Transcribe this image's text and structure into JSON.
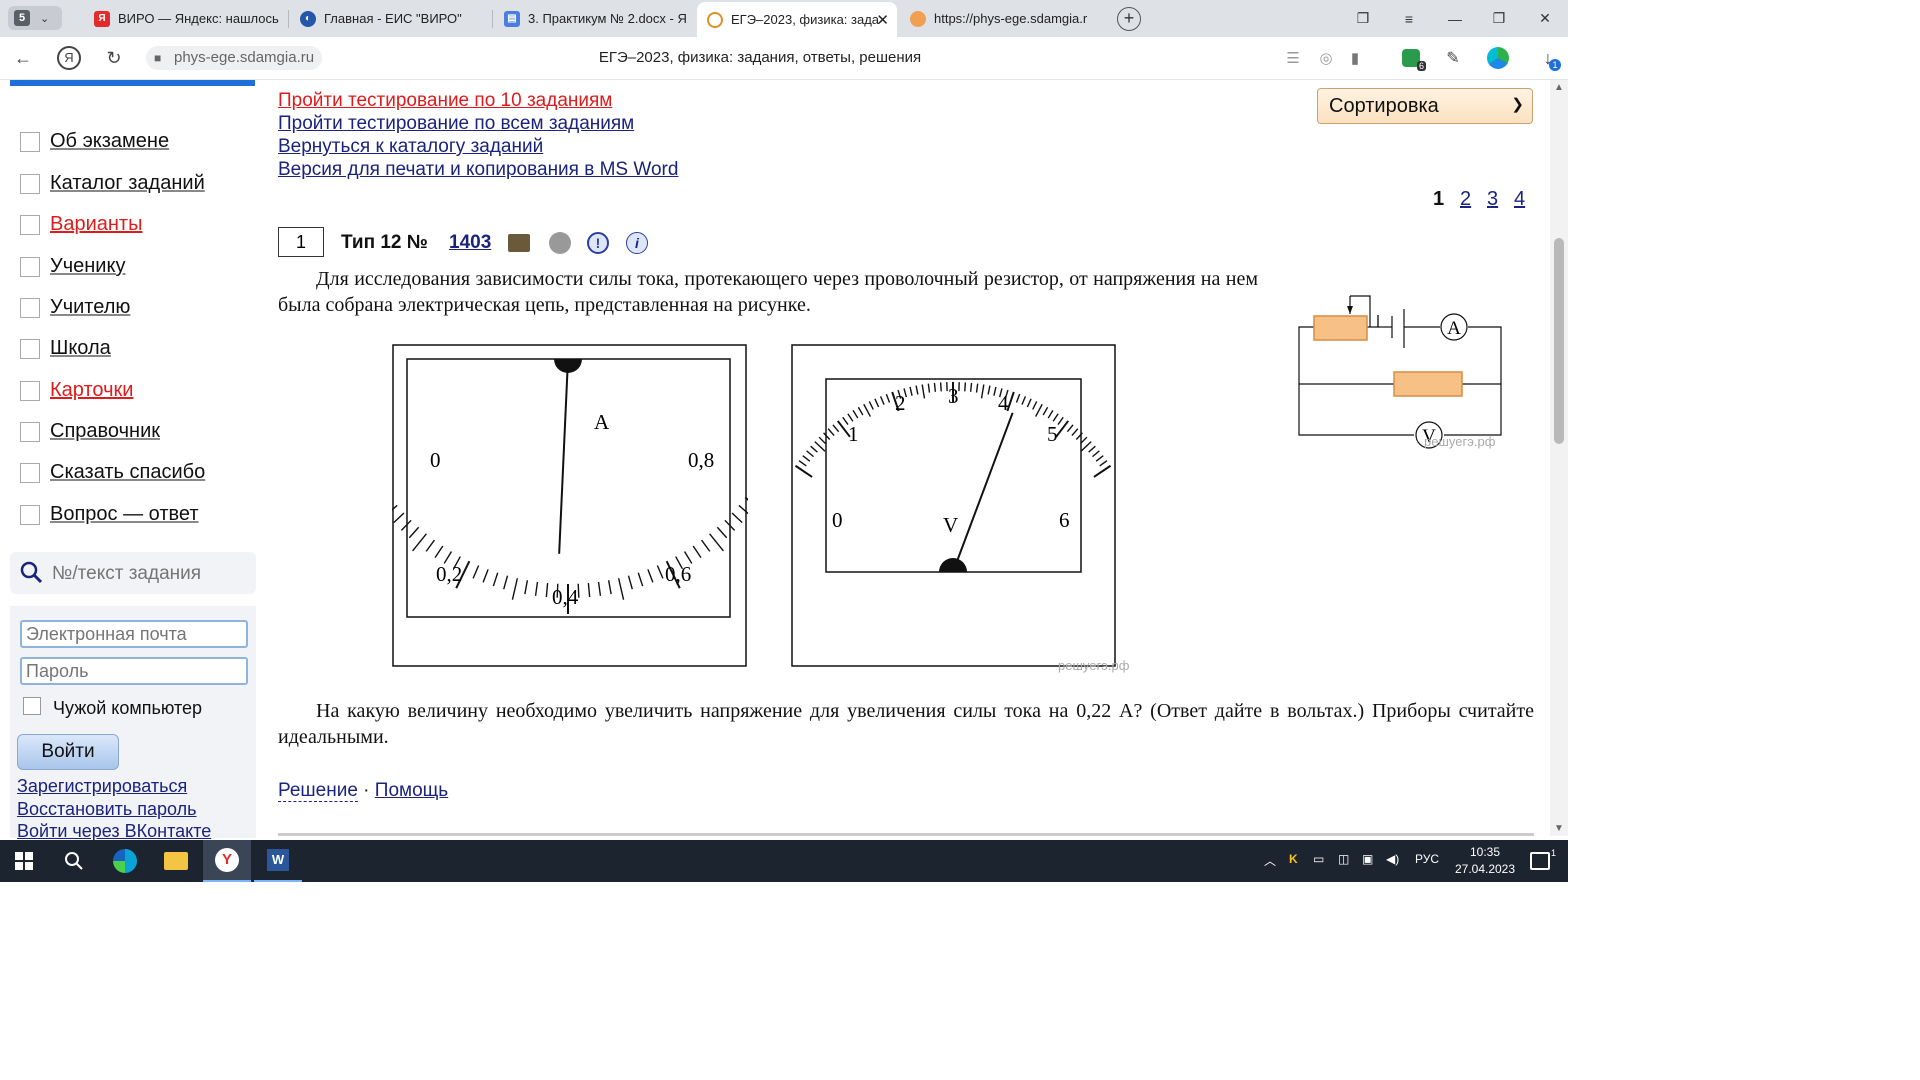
{
  "browser": {
    "tab_counter": "5",
    "tabs": [
      {
        "title": "ВИРО — Яндекс: нашлось"
      },
      {
        "title": "Главная - ЕИС \"ВИРО\""
      },
      {
        "title": "3. Практикум № 2.docx - Я"
      },
      {
        "title": "ЕГЭ–2023, физика: зада"
      },
      {
        "title": "https://phys-ege.sdamgia.r"
      }
    ],
    "domain": "phys-ege.sdamgia.ru",
    "page_title": "ЕГЭ–2023, физика: задания, ответы, решения",
    "extensions_badge": "6",
    "download_badge": "1"
  },
  "sidebar": {
    "nav": [
      {
        "label": "Об экзамене",
        "red": false
      },
      {
        "label": "Каталог заданий",
        "red": false
      },
      {
        "label": "Варианты",
        "red": true
      },
      {
        "label": "Ученику",
        "red": false
      },
      {
        "label": "Учителю",
        "red": false
      },
      {
        "label": "Школа",
        "red": false
      },
      {
        "label": "Карточки",
        "red": true
      },
      {
        "label": "Справочник",
        "red": false
      },
      {
        "label": "Сказать спасибо",
        "red": false
      },
      {
        "label": "Вопрос — ответ",
        "red": false
      }
    ],
    "search_placeholder": "№/текст задания",
    "email_placeholder": "Электронная почта",
    "password_placeholder": "Пароль",
    "foreign_computer": "Чужой компьютер",
    "login_button": "Войти",
    "register": "Зарегистрироваться",
    "restore": "Восстановить пароль",
    "vk": "Войти через ВКонтакте"
  },
  "main": {
    "links": [
      "Пройти тестирование по 10 заданиям",
      "Пройти тестирование по всем заданиям",
      "Вернуться к каталогу заданий",
      "Версия для печати и копирования в MS Word"
    ],
    "sort_label": "Сортировка",
    "pages": [
      "1",
      "2",
      "3",
      "4"
    ],
    "current_page": "1",
    "task": {
      "number": "1",
      "type_label": "Тип 12 №",
      "id": "1403",
      "paragraph1": "Для исследования зависимости силы тока, протекающего через проволочный резистор, от напряжения на нем была собрана электрическая цепь, представленная на рисунке.",
      "paragraph2": "На какую величину необходимо увеличить напряжение для увеличения силы тока на 0,22 А? (Ответ дайте в вольтах.) Приборы считайте идеальными.",
      "solution": "Решение",
      "separator": "·",
      "help": "Помощь"
    },
    "watermark": "решуегэ.рф"
  },
  "figures": {
    "ammeter": {
      "unit": "A",
      "labels": [
        "0",
        "0,2",
        "0,4",
        "0,6",
        "0,8"
      ],
      "reading": 0.38
    },
    "voltmeter": {
      "unit": "V",
      "labels": [
        "0",
        "1",
        "2",
        "3",
        "4",
        "5",
        "6"
      ],
      "reading": 4.1
    },
    "circuit": {
      "ammeter_symbol": "A",
      "voltmeter_symbol": "V"
    },
    "colors": {
      "resistor_fill": "#f7c185",
      "resistor_stroke": "#d38d45"
    }
  },
  "taskbar": {
    "lang": "РУС",
    "time": "10:35",
    "date": "27.04.2023",
    "notif_count": "1"
  }
}
